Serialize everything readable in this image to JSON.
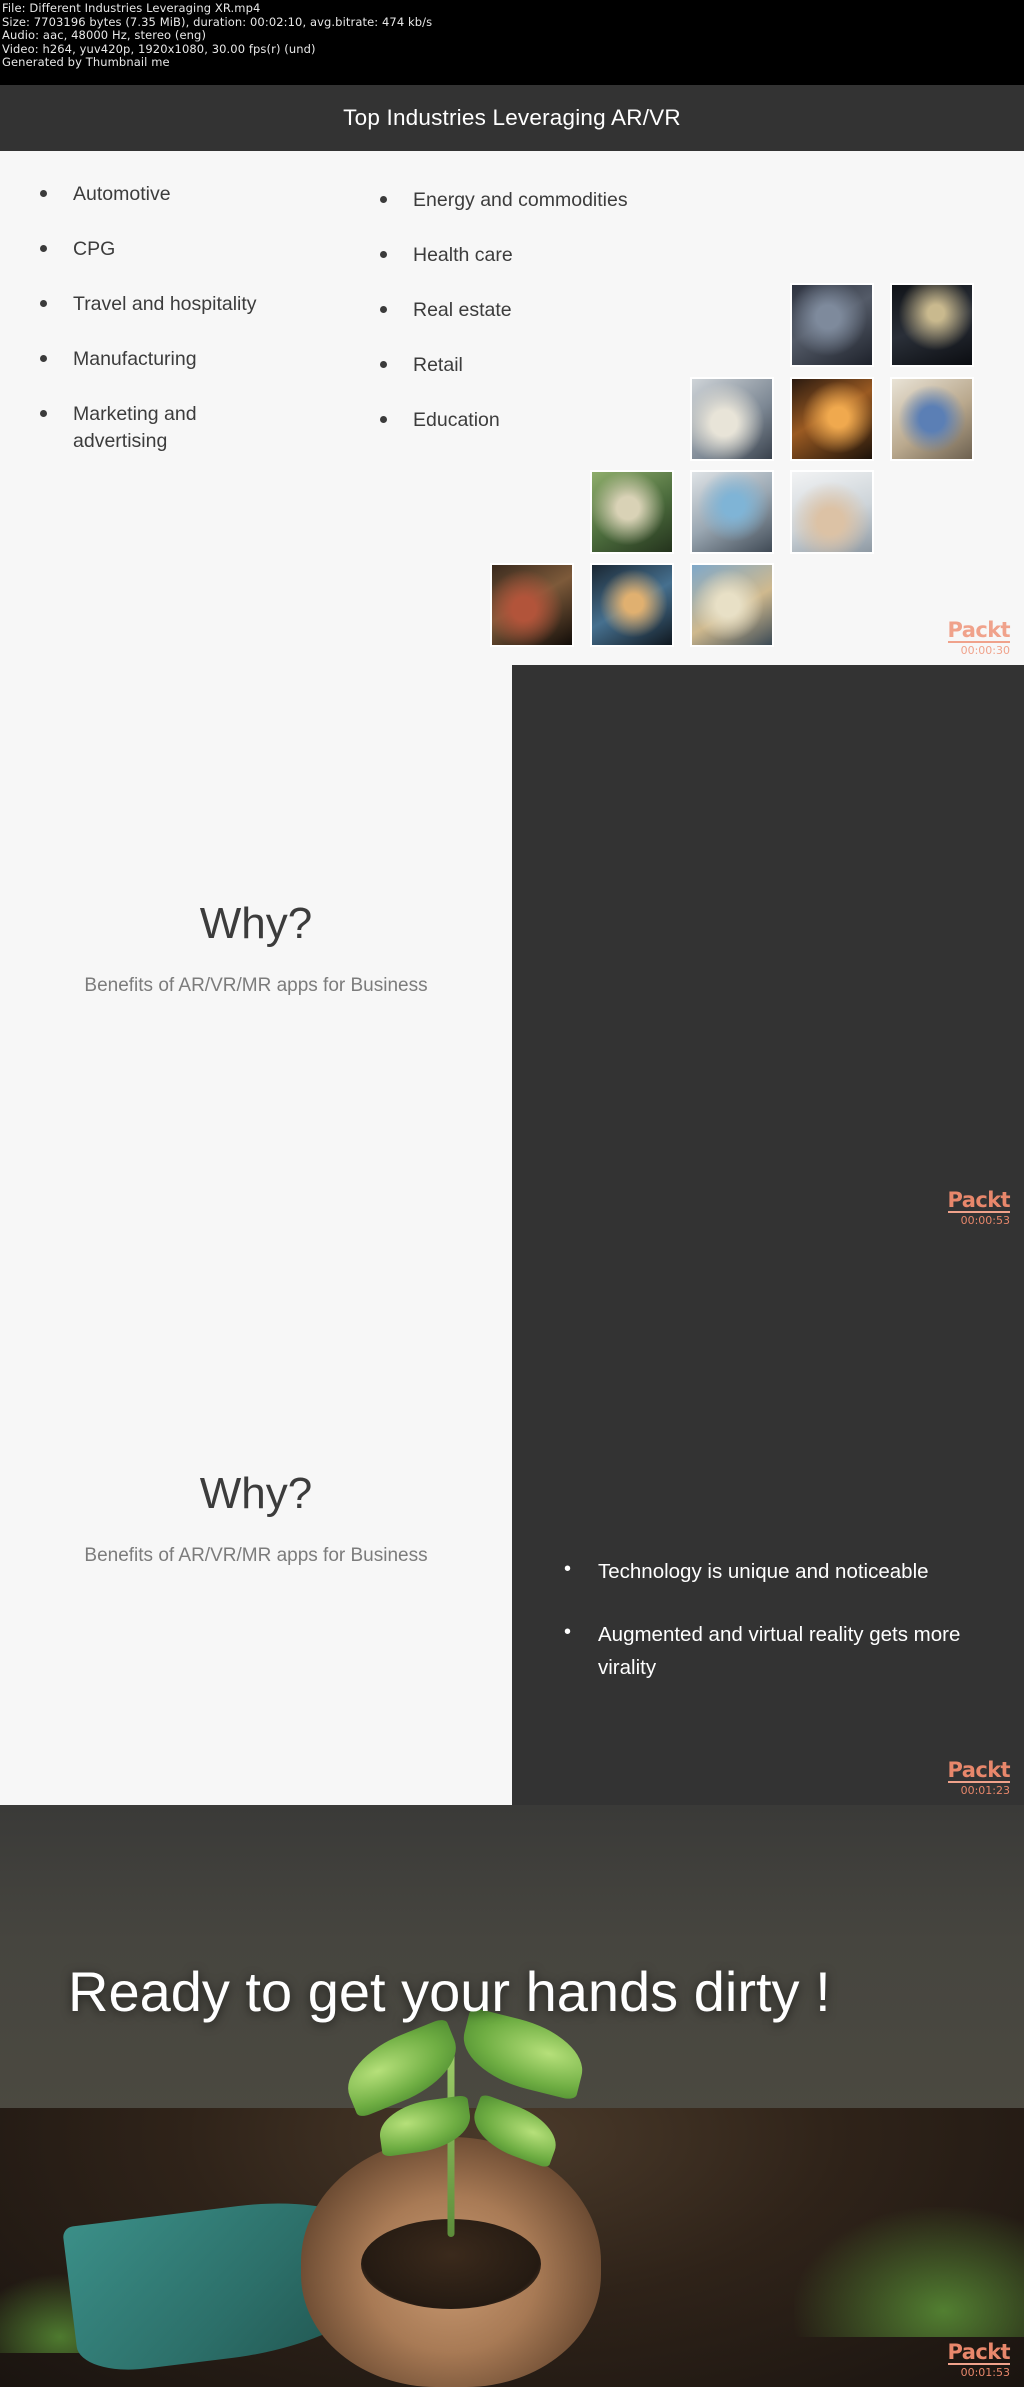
{
  "meta": {
    "file_line": "File: Different Industries Leveraging XR.mp4",
    "size_line": "Size: 7703196 bytes (7.35 MiB), duration: 00:02:10, avg.bitrate: 474 kb/s",
    "audio_line": "Audio: aac, 48000 Hz, stereo (eng)",
    "video_line": "Video: h264, yuv420p, 1920x1080, 30.00 fps(r) (und)",
    "generator_line": "Generated by Thumbnail me"
  },
  "brand": {
    "name": "Packt",
    "accent": "#f0a28b",
    "accent_dark": "#e8876b"
  },
  "slides": [
    {
      "id": "slide-1",
      "title": "Top Industries Leveraging AR/VR",
      "timestamp": "00:00:30",
      "left_bullets": [
        "Automotive",
        "CPG",
        "Travel and hospitality",
        "Manufacturing",
        "Marketing and advertising"
      ],
      "right_bullets": [
        "Energy and commodities",
        "Health care",
        "Real estate",
        "Retail",
        "Education"
      ]
    },
    {
      "id": "slide-2",
      "heading": "Why?",
      "subheading": "Benefits of AR/VR/MR apps for Business",
      "timestamp": "00:00:53",
      "points": []
    },
    {
      "id": "slide-3",
      "heading": "Why?",
      "subheading": "Benefits of AR/VR/MR apps for Business",
      "timestamp": "00:01:23",
      "points": [
        "Technology is unique and noticeable",
        "Augmented and virtual reality gets more virality"
      ]
    },
    {
      "id": "slide-4",
      "heading": "Ready to get your hands dirty !",
      "timestamp": "00:01:53"
    }
  ]
}
